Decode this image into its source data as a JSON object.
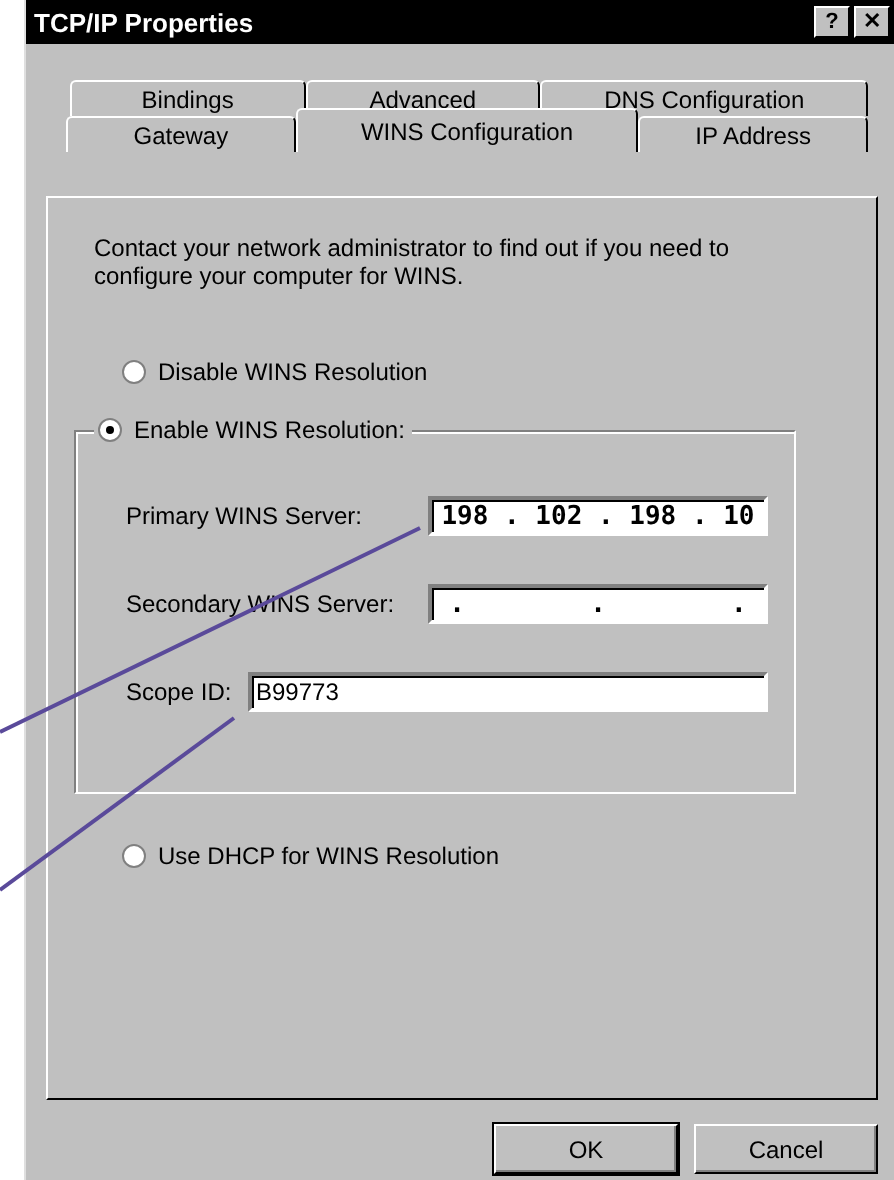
{
  "window": {
    "title": "TCP/IP Properties",
    "help_button": "?",
    "close_button": "✕"
  },
  "tab_rows": [
    {
      "tabs": [
        {
          "label": "Bindings",
          "selected": false
        },
        {
          "label": "Advanced",
          "selected": false
        },
        {
          "label": "DNS Configuration",
          "selected": false
        }
      ]
    },
    {
      "tabs": [
        {
          "label": "Gateway",
          "selected": false
        },
        {
          "label": "WINS Configuration",
          "selected": true
        },
        {
          "label": "IP Address",
          "selected": false
        }
      ]
    }
  ],
  "intro": "Contact your network administrator to find out if you need to configure your computer for WINS.",
  "disable_option": {
    "label": "Disable WINS Resolution",
    "selected": false
  },
  "enable_option": {
    "label": "Enable WINS Resolution:",
    "selected": true
  },
  "fields": [
    {
      "label": "Primary WINS Server:",
      "kind": "ip",
      "value": "198 . 102 . 198 . 10"
    },
    {
      "label": "Secondary WINS Server:",
      "kind": "ip",
      "value": ".        .        ."
    },
    {
      "label": "Scope ID:",
      "kind": "text",
      "value": "B99773"
    }
  ],
  "dhcp_option": {
    "label": "Use DHCP for WINS Resolution",
    "selected": false
  },
  "buttons": [
    {
      "label": "OK",
      "default": true
    },
    {
      "label": "Cancel",
      "default": false
    }
  ]
}
